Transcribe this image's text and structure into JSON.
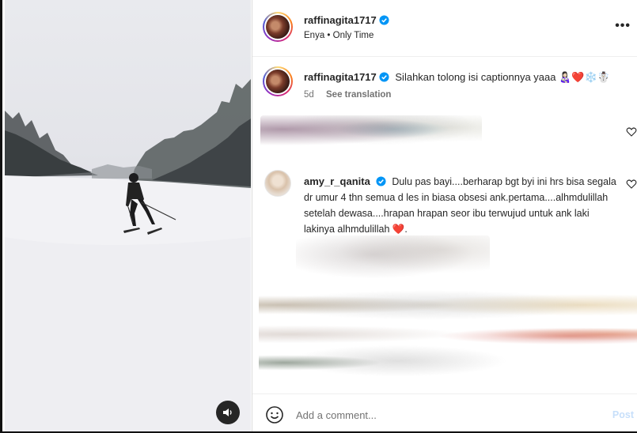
{
  "media": {
    "sound_icon": "speaker-icon"
  },
  "header": {
    "username": "raffinagita1717",
    "audio": "Enya • Only Time",
    "more_label": "•••"
  },
  "caption": {
    "username": "raffinagita1717",
    "text": "Silahkan tolong isi captionnya yaaa 👩🏻‍🍼❤️❄️☃️",
    "age": "5d",
    "translate_label": "See translation"
  },
  "comments": [
    {
      "username": "amy_r_qanita",
      "text": "Dulu pas bayi....berharap bgt byi ini hrs bisa segala dr umur 4 thn semua d les in biasa obsesi ank.pertama....alhmdulillah setelah dewasa....hrapan hrapan seor ibu terwujud untuk ank laki lakinya alhmdulillah ❤️."
    }
  ],
  "footer": {
    "placeholder": "Add a comment...",
    "post_label": "Post"
  },
  "colors": {
    "verified": "#0095f6",
    "heart": "#c0202a",
    "post_disabled": "#c7dffa"
  }
}
